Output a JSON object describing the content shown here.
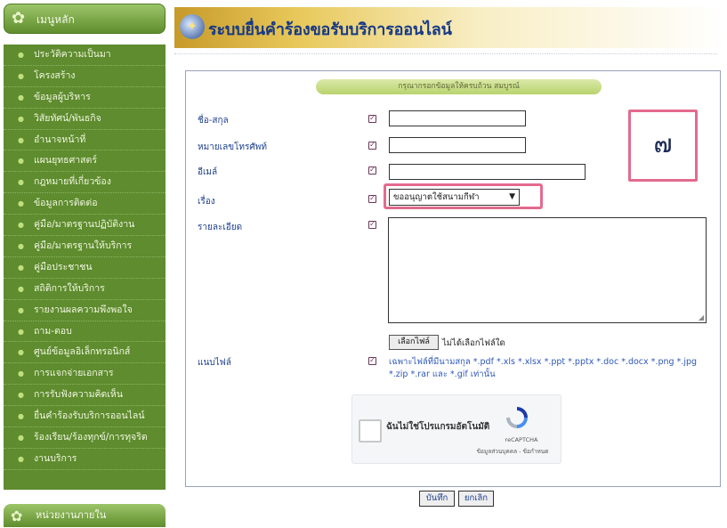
{
  "sidebar": {
    "header": "เมนูหลัก",
    "items": [
      {
        "label": "ประวัติความเป็นมา"
      },
      {
        "label": "โครงสร้าง"
      },
      {
        "label": "ข้อมูลผู้บริหาร"
      },
      {
        "label": "วิสัยทัศน์/พันธกิจ"
      },
      {
        "label": "อำนาจหน้าที่"
      },
      {
        "label": "แผนยุทธศาสตร์"
      },
      {
        "label": "กฎหมายที่เกี่ยวข้อง"
      },
      {
        "label": "ข้อมูลการติดต่อ"
      },
      {
        "label": "คู่มือ/มาตรฐานปฏิบัติงาน"
      },
      {
        "label": "คู่มือ/มาตรฐานให้บริการ"
      },
      {
        "label": "คู่มือประชาชน"
      },
      {
        "label": "สถิติการให้บริการ"
      },
      {
        "label": "รายงานผลความพึงพอใจ"
      },
      {
        "label": "ถาม-ตอบ"
      },
      {
        "label": "ศูนย์ข้อมูลอิเล็กทรอนิกส์"
      },
      {
        "label": "การแจกจ่ายเอกสาร"
      },
      {
        "label": "การรับฟังความคิดเห็น"
      },
      {
        "label": "ยื่นคำร้องรับบริการออนไลน์"
      },
      {
        "label": "ร้องเรียน/ร้องทุกข์/การทุจริต"
      },
      {
        "label": "งานบริการ"
      }
    ],
    "footer": "หน่วยงานภายใน"
  },
  "header": {
    "title": "ระบบยื่นคำร้องขอรับบริการออนไลน์"
  },
  "form": {
    "notice": "กรุณากรอกข้อมูลให้ครบถ้วน สมบูรณ์",
    "fields": {
      "name_label": "ชื่อ-สกุล",
      "phone_label": "หมายเลขโทรศัพท์",
      "email_label": "อีเมล์",
      "subject_label": "เรื่อง",
      "subject_value": "ขออนุญาตใช้สนามกีฬา",
      "detail_label": "รายละเอียด",
      "attach_label": "แนบไฟล์"
    },
    "file": {
      "button": "เลือกไฟล์",
      "status": "ไม่ได้เลือกไฟล์ใด",
      "hint": "เฉพาะไฟล์ที่มีนามสกุล *.pdf *.xls *.xlsx *.ppt *.pptx *.doc *.docx *.png *.jpg *.zip *.rar และ *.gif เท่านั้น"
    },
    "captcha": {
      "label": "ฉันไม่ใช่โปรแกรมอัตโนมัติ",
      "brand": "reCAPTCHA",
      "terms": "ข้อมูลส่วนบุคคล - ข้อกำหนด"
    },
    "submit": "บันทึก",
    "cancel": "ยกเลิก"
  },
  "annotation": {
    "number": "๗"
  },
  "colors": {
    "sidebar_green": "#5e8c2e",
    "title_blue": "#173a86",
    "label_blue": "#1d3f8f",
    "highlight_pink": "#e36a8e"
  }
}
